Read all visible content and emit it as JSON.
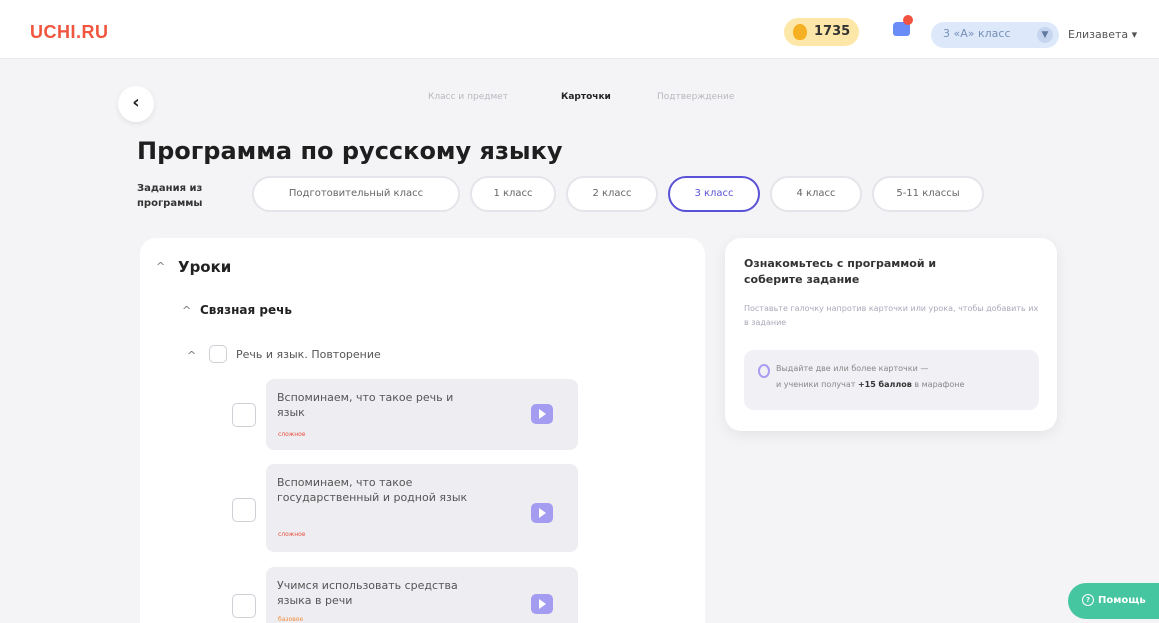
{
  "header": {
    "logo": "UCHI.RU",
    "coins": "1735",
    "class_select": "3 «А» класс",
    "user": "Елизавета ▾"
  },
  "steps": [
    "Класс и предмет",
    "Карточки",
    "Подтверждение"
  ],
  "page_title": "Программа по русскому языку",
  "tasks_label": "Задания из программы",
  "grade_pills": [
    "Подготовительный класс",
    "1 класс",
    "2 класс",
    "3 класс",
    "4 класс",
    "5-11 классы"
  ],
  "selected_grade": "3 класс",
  "lessons": {
    "title": "Уроки",
    "section": "Связная речь",
    "topic": "Речь и язык. Повторение",
    "items": [
      {
        "text": "Вспоминаем, что такое речь и язык",
        "tag": "сложное"
      },
      {
        "text": "Вспоминаем, что такое государственный и родной язык",
        "tag": "сложное"
      },
      {
        "text": "Учимся использовать средства языка в речи",
        "tag": "базовое"
      }
    ]
  },
  "info": {
    "title": "Ознакомьтесь с программой и соберите задание",
    "text": "Поставьте галочку напротив карточки или урока, чтобы добавить их в задание",
    "hint_line1": "Выдайте две или более карточки —",
    "hint_line2_pre": "и ученики получат ",
    "hint_bonus": "+15 баллов",
    "hint_line2_post": " в марафоне"
  },
  "help_label": "Помощь",
  "icons": {
    "back": "chevron-left-icon",
    "coin": "coin-icon",
    "notification": "bell-icon",
    "play": "play-icon",
    "hint": "bulb-icon",
    "help": "question-icon"
  },
  "colors": {
    "brand": "#f0553d",
    "accent": "#5a52d6",
    "play": "#a49cf0",
    "help": "#46c6a0"
  }
}
